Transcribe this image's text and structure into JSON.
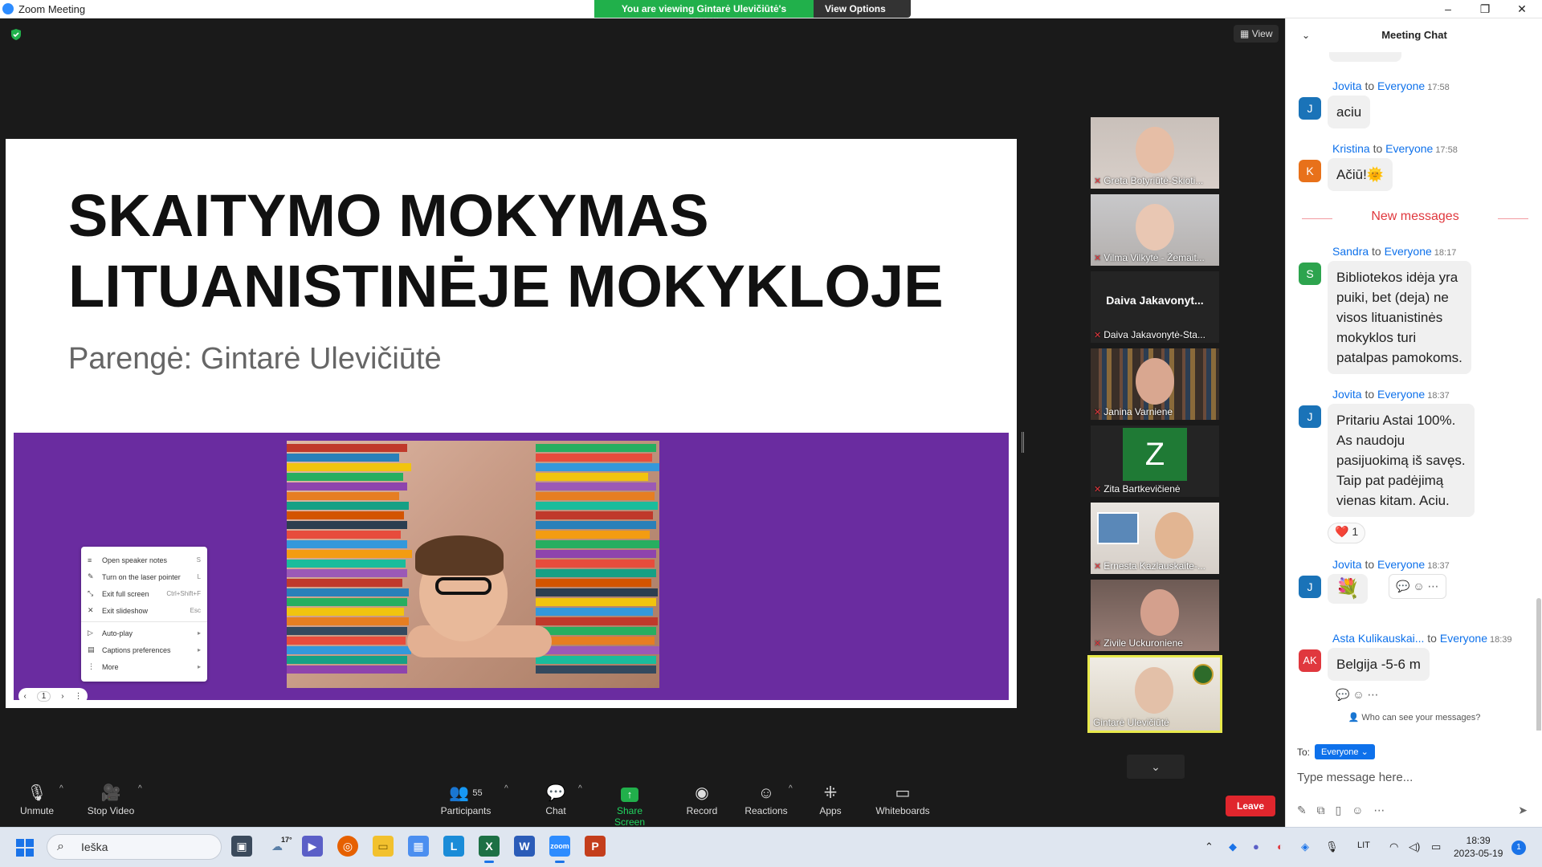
{
  "window": {
    "title": "Zoom Meeting",
    "viewing_banner": "You are viewing Gintarė Ulevičiūtė's screen",
    "view_options": "View Options",
    "minimize": "–",
    "restore": "❐",
    "close": "✕"
  },
  "meeting": {
    "view_label": "View"
  },
  "slide": {
    "title_line1": "SKAITYMO MOKYMAS",
    "title_line2": "LITUANISTINĖJE MOKYKLOJE",
    "subtitle": "Parengė: Gintarė Ulevičiūtė",
    "menu": [
      {
        "label": "Open speaker notes",
        "shortcut": "S",
        "icon": "≡"
      },
      {
        "label": "Turn on the laser pointer",
        "shortcut": "L",
        "icon": "✎"
      },
      {
        "label": "Exit full screen",
        "shortcut": "Ctrl+Shift+F",
        "icon": "⤡"
      },
      {
        "label": "Exit slideshow",
        "shortcut": "Esc",
        "icon": "✕"
      },
      {
        "label": "Auto-play",
        "shortcut": "▸",
        "icon": "▷"
      },
      {
        "label": "Captions preferences",
        "shortcut": "▸",
        "icon": "▤"
      },
      {
        "label": "More",
        "shortcut": "▸",
        "icon": "⋮"
      }
    ],
    "nav": {
      "prev": "‹",
      "page": "1",
      "next": "›",
      "more": "⋮"
    }
  },
  "participants_strip": [
    {
      "name": "Greta Botyriūtė-Skioti...",
      "muted": true
    },
    {
      "name": "Vilma Vilkytė - Žemait...",
      "muted": true
    },
    {
      "name": "Daiva Jakavonytė-Sta...",
      "muted": true,
      "big_name": "Daiva  Jakavonyt..."
    },
    {
      "name": "Janina Varniene",
      "muted": true
    },
    {
      "name": "Zita Bartkevičienė",
      "muted": true,
      "avatar_letter": "Z"
    },
    {
      "name": "Ernesta Kazlauskaite-...",
      "muted": true
    },
    {
      "name": "Zivile Uckuroniene",
      "muted": true
    },
    {
      "name": "Gintarė Ulevičiūtė",
      "muted": false,
      "active": true
    }
  ],
  "toolbar": {
    "unmute": "Unmute",
    "stop_video": "Stop Video",
    "participants": "Participants",
    "participants_count": "55",
    "chat": "Chat",
    "share_screen": "Share Screen",
    "record": "Record",
    "reactions": "Reactions",
    "apps": "Apps",
    "whiteboards": "Whiteboards",
    "leave": "Leave"
  },
  "chat": {
    "header": "Meeting Chat",
    "to_word": "to",
    "messages": [
      {
        "sender": "Jovita",
        "to": "Everyone",
        "time": "17:58",
        "text": "aciu",
        "avatar": "J",
        "color": "#1a73b8"
      },
      {
        "sender": "Kristina",
        "to": "Everyone",
        "time": "17:58",
        "text": "Ačiū!",
        "emoji": "🌞",
        "avatar": "K",
        "color": "#e8711a"
      },
      {
        "sender": "Sandra",
        "to": "Everyone",
        "time": "18:17",
        "text_lines": [
          "Bibliotekos idėja yra",
          "puiki, bet (deja) ne",
          "visos lituanistinės",
          "mokyklos turi",
          "patalpas pamokoms."
        ],
        "avatar": "S",
        "color": "#2da44e"
      },
      {
        "sender": "Jovita",
        "to": "Everyone",
        "time": "18:37",
        "text_lines": [
          "Pritariu Astai 100%.",
          "As  naudoju",
          "pasijuokimą iš savęs.",
          "Taip pat padėjimą",
          "vienas kitam. Aciu."
        ],
        "avatar": "J",
        "color": "#1a73b8",
        "reaction": "❤️",
        "reaction_count": "1"
      },
      {
        "sender": "Jovita",
        "to": "Everyone",
        "time": "18:37",
        "emoji": "💐",
        "avatar": "J",
        "color": "#1a73b8"
      },
      {
        "sender": "Asta Kulikauskai...",
        "to": "Everyone",
        "time": "18:39",
        "text": "Belgija -5-6 m",
        "avatar": "AK",
        "color": "#e0383e"
      }
    ],
    "new_messages": "New messages",
    "who_can_see": "Who can see your messages?",
    "to_label": "To:",
    "to_value": "Everyone",
    "input_placeholder": "Type message here..."
  },
  "taskbar": {
    "search": "Ieška",
    "weather": "17°",
    "lang": "LIT",
    "time": "18:39",
    "date": "2023-05-19",
    "notifications": "1"
  }
}
